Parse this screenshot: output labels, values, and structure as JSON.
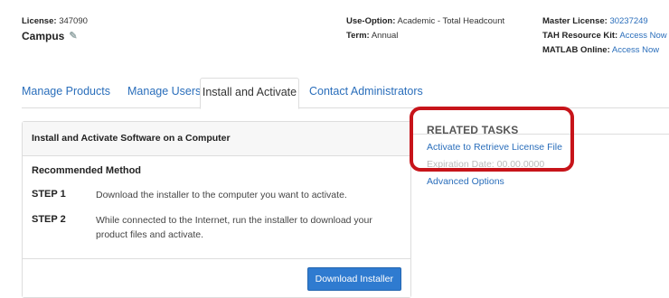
{
  "license": {
    "label": "License:",
    "number": "347090",
    "name": "Campus"
  },
  "license_meta": {
    "use_label": "Use-Option:",
    "use_value": "Academic - Total Headcount",
    "term_label": "Term:",
    "term_value": "Annual"
  },
  "master": {
    "master_label": "Master License:",
    "master_value": "30237249",
    "tah_label": "TAH Resource Kit:",
    "tah_value": "Access Now",
    "matlab_label": "MATLAB Online:",
    "matlab_value": "Access Now"
  },
  "tabs": [
    "Manage Products",
    "Manage Users",
    "Install and Activate",
    "Contact Administrators"
  ],
  "panel": {
    "title": "Install and Activate Software on a Computer",
    "recommended": "Recommended Method",
    "steps": [
      {
        "label": "STEP 1",
        "text": "Download the installer to the computer you want to activate."
      },
      {
        "label": "STEP 2",
        "text": "While connected to the Internet, run the installer to download your product files and activate."
      }
    ],
    "button": "Download Installer"
  },
  "related": {
    "title": "RELATED TASKS",
    "links": [
      "Activate to Retrieve License File",
      "Advanced Options"
    ],
    "obscured_text": "Expiration Date: 00.00.0000"
  },
  "colors": {
    "accent": "#2a6ebb",
    "button": "#2f7bd0",
    "highlight": "#c7141a"
  }
}
